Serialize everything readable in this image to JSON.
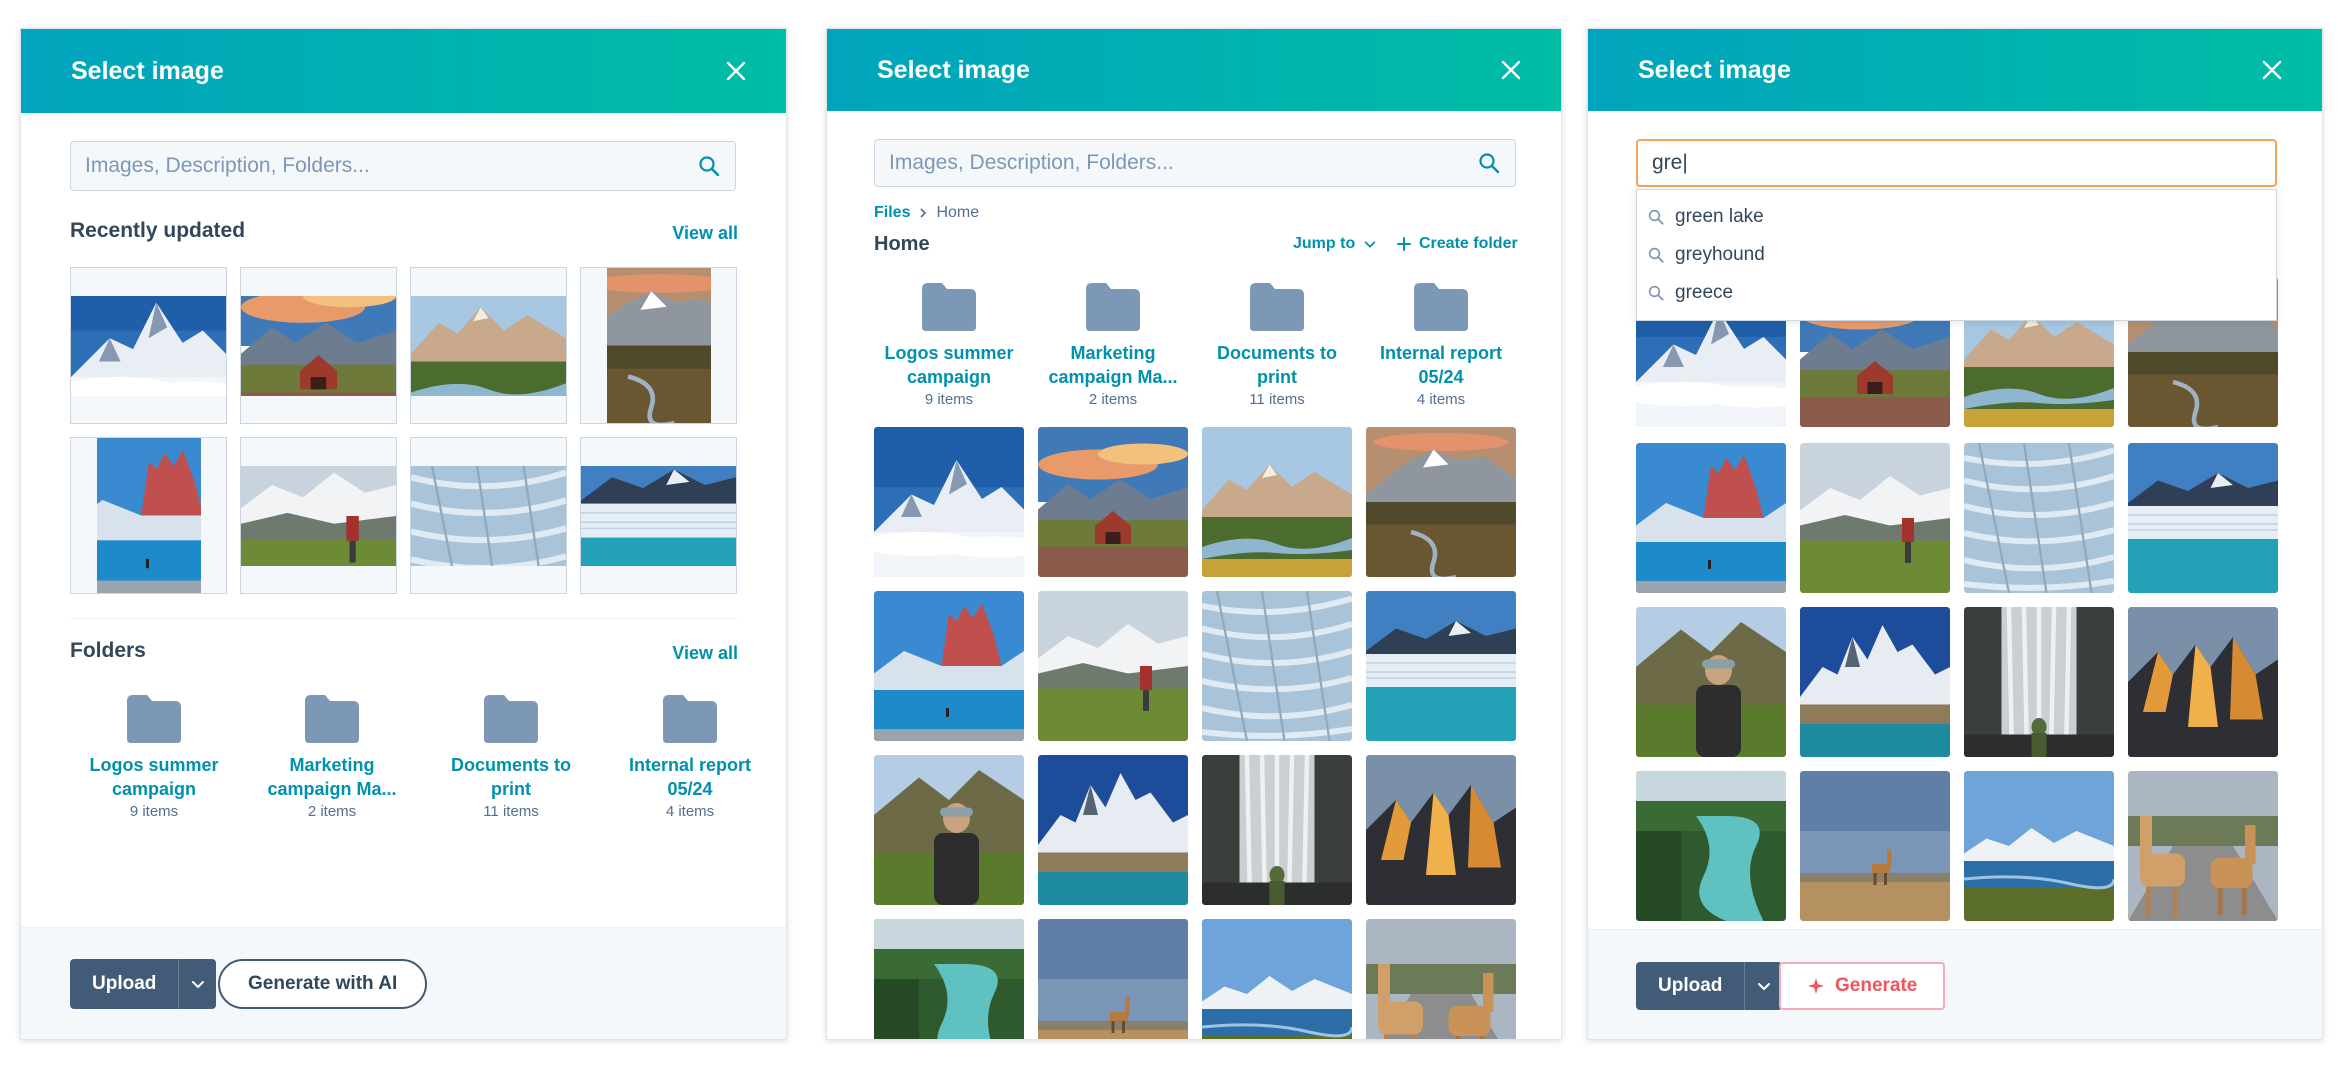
{
  "panel1": {
    "title": "Select image",
    "search_placeholder": "Images, Description, Folders...",
    "recent_title": "Recently updated",
    "recent_view_all": "View all",
    "folders_title": "Folders",
    "folders_view_all": "View all",
    "upload_label": "Upload",
    "generate_ai_label": "Generate with AI"
  },
  "panel2": {
    "title": "Select image",
    "search_placeholder": "Images, Description, Folders...",
    "breadcrumb_root": "Files",
    "breadcrumb_current": "Home",
    "heading": "Home",
    "jump_to": "Jump to",
    "create_folder": "Create folder"
  },
  "panel3": {
    "title": "Select image",
    "search_value": "gre|",
    "suggestions": [
      "green lake",
      "greyhound",
      "greece"
    ],
    "upload_label": "Upload",
    "generate_label": "Generate"
  },
  "folders": [
    {
      "name": "Logos summer campaign",
      "count": "9 items"
    },
    {
      "name": "Marketing campaign Ma...",
      "count": "2 items"
    },
    {
      "name": "Documents to print",
      "count": "11 items"
    },
    {
      "name": "Internal report 05/24",
      "count": "4 items"
    }
  ],
  "colors": {
    "header_start": "#00a4bd",
    "header_end": "#00bda5",
    "link": "#0091ae",
    "folder_icon": "#7c98b6",
    "primary_button": "#425b76",
    "generate_accent": "#f2545b"
  },
  "images": [
    "mountain-peak-clouds",
    "red-barn-landscape",
    "mountain-valley-river",
    "mountain-forest-portrait",
    "red-spires-lake",
    "hiker-mountain-trail",
    "glacier-ice-texture",
    "glacier-lagoon",
    "hiker-back-view",
    "mountain-lake-peaks",
    "waterfall-hiker",
    "golden-peaks",
    "river-forest-canyon",
    "vicuna-plains",
    "lake-snowy-mountains",
    "llamas-road"
  ]
}
